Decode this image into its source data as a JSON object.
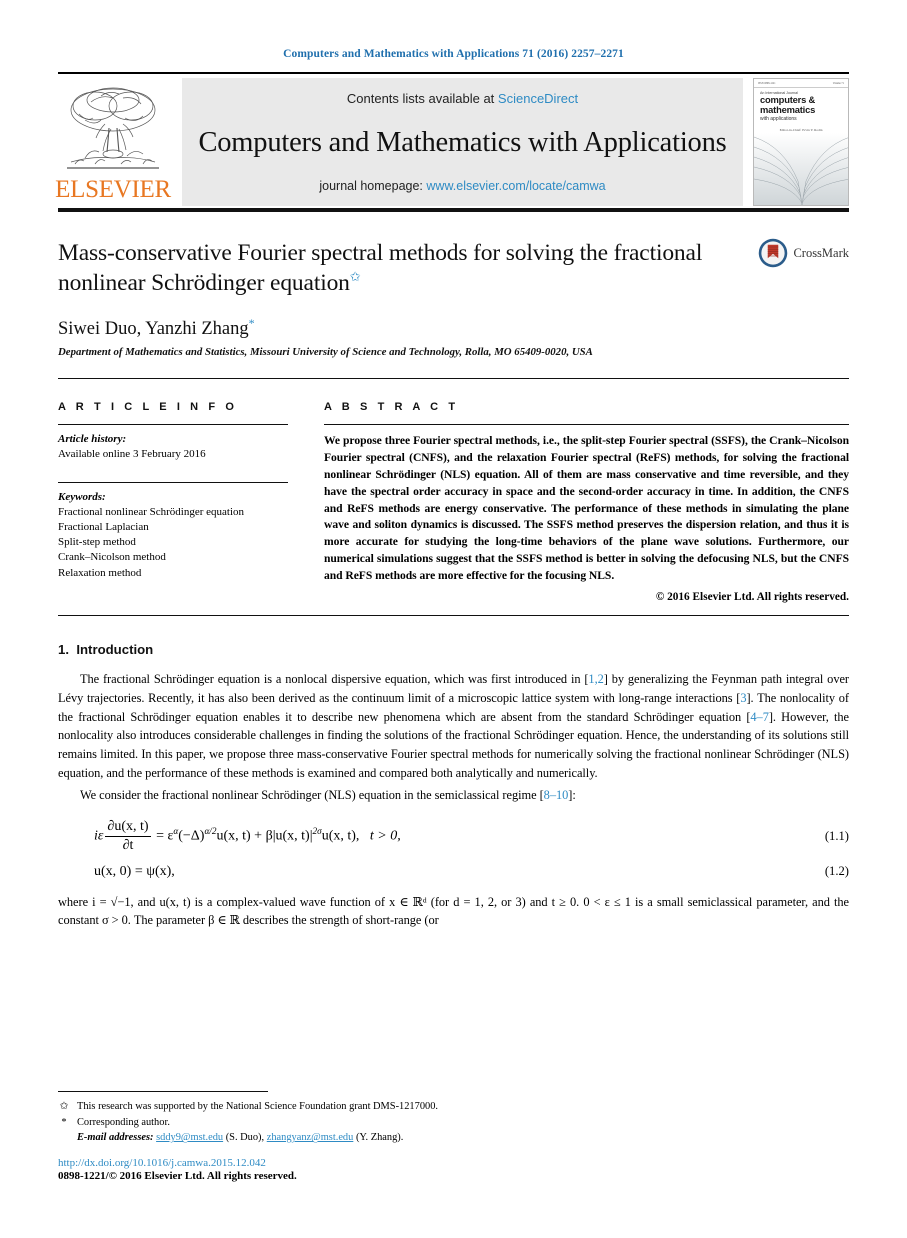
{
  "running_head": "Computers and Mathematics with Applications 71 (2016) 2257–2271",
  "masthead": {
    "publisher_logo_name": "elsevier-tree-logo",
    "publisher_wordmark": "ELSEVIER",
    "contents_prefix": "Contents lists available at",
    "contents_link": "ScienceDirect",
    "journal_title": "Computers and Mathematics with Applications",
    "homepage_prefix": "journal homepage:",
    "homepage_link": "www.elsevier.com/locate/camwa",
    "cover": {
      "top_left": "ISSN 0898-1221",
      "top_right": "Volume 71",
      "kicker": "An International Journal",
      "line1": "computers &",
      "line2": "mathematics",
      "line3": "with applications",
      "editor": "Editor-in-Chief: Ervin Y. Rodin"
    }
  },
  "article": {
    "title": "Mass-conservative Fourier spectral methods for solving the fractional nonlinear Schrödinger equation",
    "title_footnote_mark": "✩",
    "authors": "Siwei Duo, Yanzhi Zhang",
    "author_corresponding_mark": "*",
    "affiliation": "Department of Mathematics and Statistics, Missouri University of Science and Technology, Rolla, MO 65409-0020, USA",
    "crossmark_label": "CrossMark"
  },
  "info": {
    "label": "A R T I C L E    I N F O",
    "history_head": "Article history:",
    "history_line": "Available online 3 February 2016",
    "keywords_head": "Keywords:",
    "keywords": [
      "Fractional nonlinear Schrödinger equation",
      "Fractional Laplacian",
      "Split-step method",
      "Crank–Nicolson method",
      "Relaxation method"
    ]
  },
  "abstract": {
    "label": "A B S T R A C T",
    "text": "We propose three Fourier spectral methods, i.e., the split-step Fourier spectral (SSFS), the Crank–Nicolson Fourier spectral (CNFS), and the relaxation Fourier spectral (ReFS) methods, for solving the fractional nonlinear Schrödinger (NLS) equation. All of them are mass conservative and time reversible, and they have the spectral order accuracy in space and the second-order accuracy in time. In addition, the CNFS and ReFS methods are energy conservative. The performance of these methods in simulating the plane wave and soliton dynamics is discussed. The SSFS method preserves the dispersion relation, and thus it is more accurate for studying the long-time behaviors of the plane wave solutions. Furthermore, our numerical simulations suggest that the SSFS method is better in solving the defocusing NLS, but the CNFS and ReFS methods are more effective for the focusing NLS.",
    "copyright": "© 2016 Elsevier Ltd. All rights reserved."
  },
  "body": {
    "section_number": "1.",
    "section_title": "Introduction",
    "para1_a": "The fractional Schrödinger equation is a nonlocal dispersive equation, which was first introduced in [",
    "para1_ref1": "1,2",
    "para1_b": "] by generalizing the Feynman path integral over Lévy trajectories. Recently, it has also been derived as the continuum limit of a microscopic lattice system with long-range interactions [",
    "para1_ref2": "3",
    "para1_c": "]. The nonlocality of the fractional Schrödinger equation enables it to describe new phenomena which are absent from the standard Schrödinger equation [",
    "para1_ref3": "4–7",
    "para1_d": "]. However, the nonlocality also introduces considerable challenges in finding the solutions of the fractional Schrödinger equation. Hence, the understanding of its solutions still remains limited. In this paper, we propose three mass-conservative Fourier spectral methods for numerically solving the fractional nonlinear Schrödinger (NLS) equation, and the performance of these methods is examined and compared both analytically and numerically.",
    "para2_a": "We consider the fractional nonlinear Schrödinger (NLS) equation in the semiclassical regime [",
    "para2_ref": "8–10",
    "para2_b": "]:",
    "para3": "where i = √−1, and u(x, t) is a complex-valued wave function of x ∈ ℝᵈ (for d = 1, 2, or 3) and t ≥ 0. 0 < ε ≤ 1 is a small semiclassical parameter, and the constant σ > 0. The parameter β ∈ ℝ describes the strength of short-range (or"
  },
  "equations": {
    "eq1_number": "(1.1)",
    "eq1_lhs_i": "i",
    "eq1_lhs_eps": "ε",
    "eq1_frac_num": "∂u(x, t)",
    "eq1_frac_den": "∂t",
    "eq1_rhs": "= ε",
    "eq1_alpha": "α",
    "eq1_laplacian": "(−Δ)",
    "eq1_lap_exp": "α/2",
    "eq1_u1": "u(x, t) + β|u(x, t)|",
    "eq1_mod_exp": "2σ",
    "eq1_u2": "u(x, t),",
    "eq1_cond": "t > 0,",
    "eq2_number": "(1.2)",
    "eq2_text": "u(x, 0) = ψ(x),"
  },
  "footnotes": {
    "f1_mark": "✩",
    "f1_text": "This research was supported by the National Science Foundation grant DMS-1217000.",
    "f2_mark": "*",
    "f2_text": "Corresponding author.",
    "email_label": "E-mail addresses:",
    "email1": "sddy9@mst.edu",
    "email1_who": "(S. Duo),",
    "email2": "zhangyanz@mst.edu",
    "email2_who": "(Y. Zhang).",
    "doi": "http://dx.doi.org/10.1016/j.camwa.2015.12.042",
    "issn_line": "0898-1221/© 2016 Elsevier Ltd. All rights reserved."
  },
  "colors": {
    "link_blue": "#2e8bc4",
    "runhead_blue": "#1f6fad",
    "elsevier_orange": "#E87722",
    "banner_gray": "#e9e9e9"
  }
}
